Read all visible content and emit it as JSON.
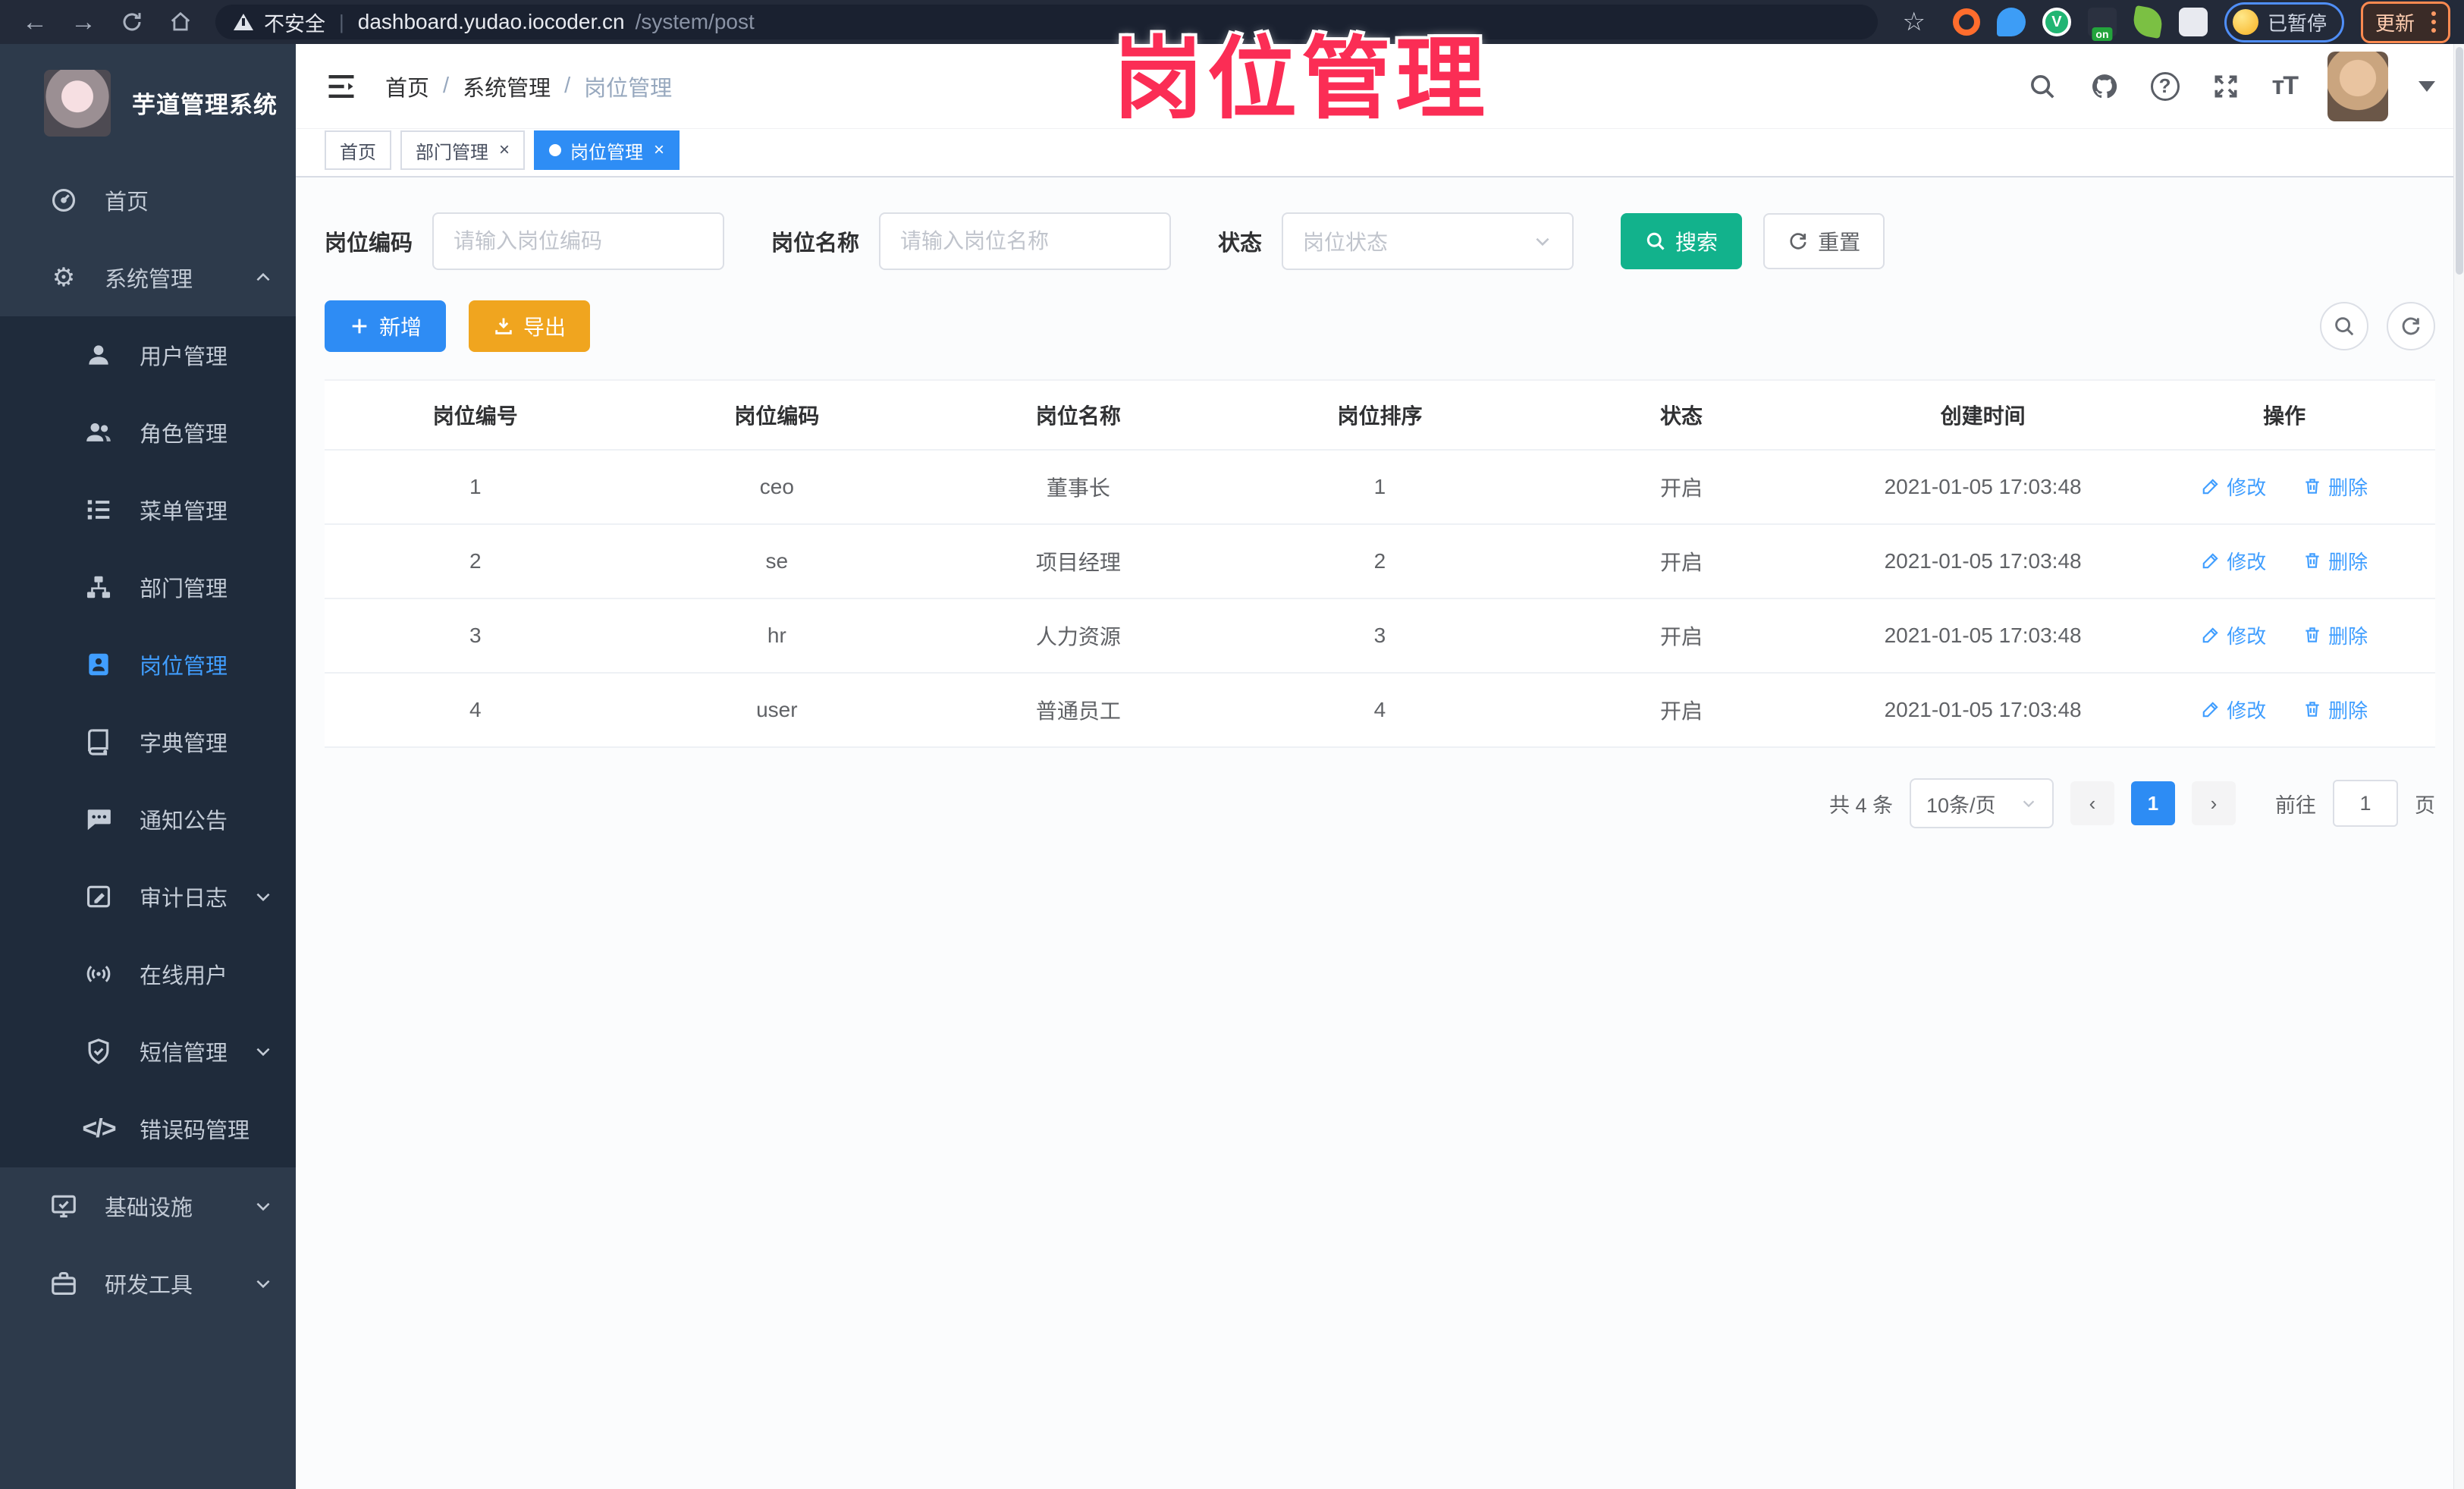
{
  "colors": {
    "primary": "#2e8cf4",
    "success": "#12b28c",
    "warning": "#f0a51f",
    "link": "#409eff",
    "sidebar_bg": "#2d3a4b",
    "submenu_bg": "#1f2b3b",
    "overlay_pink": "#fb2d55"
  },
  "browser": {
    "security_label": "不安全",
    "url_host": "dashboard.yudao.iocoder.cn",
    "url_path": "/system/post",
    "extension_badge": "on",
    "paused_label": "已暂停",
    "update_label": "更新"
  },
  "overlay": {
    "title": "岗位管理"
  },
  "sidebar": {
    "logo_title": "芋道管理系统",
    "items": [
      {
        "label": "首页"
      },
      {
        "label": "系统管理"
      },
      {
        "label": "用户管理"
      },
      {
        "label": "角色管理"
      },
      {
        "label": "菜单管理"
      },
      {
        "label": "部门管理"
      },
      {
        "label": "岗位管理"
      },
      {
        "label": "字典管理"
      },
      {
        "label": "通知公告"
      },
      {
        "label": "审计日志"
      },
      {
        "label": "在线用户"
      },
      {
        "label": "短信管理"
      },
      {
        "label": "错误码管理"
      },
      {
        "label": "基础设施"
      },
      {
        "label": "研发工具"
      }
    ]
  },
  "header": {
    "breadcrumb": [
      "首页",
      "系统管理",
      "岗位管理"
    ]
  },
  "tabs": [
    {
      "label": "首页"
    },
    {
      "label": "部门管理"
    },
    {
      "label": "岗位管理"
    }
  ],
  "filters": {
    "code_label": "岗位编码",
    "code_placeholder": "请输入岗位编码",
    "name_label": "岗位名称",
    "name_placeholder": "请输入岗位名称",
    "status_label": "状态",
    "status_placeholder": "岗位状态",
    "search_label": "搜索",
    "reset_label": "重置"
  },
  "toolbar": {
    "add_label": "新增",
    "export_label": "导出"
  },
  "table": {
    "columns": [
      "岗位编号",
      "岗位编码",
      "岗位名称",
      "岗位排序",
      "状态",
      "创建时间",
      "操作"
    ],
    "edit_label": "修改",
    "delete_label": "删除",
    "rows": [
      {
        "id": "1",
        "code": "ceo",
        "name": "董事长",
        "sort": "1",
        "status": "开启",
        "created": "2021-01-05 17:03:48"
      },
      {
        "id": "2",
        "code": "se",
        "name": "项目经理",
        "sort": "2",
        "status": "开启",
        "created": "2021-01-05 17:03:48"
      },
      {
        "id": "3",
        "code": "hr",
        "name": "人力资源",
        "sort": "3",
        "status": "开启",
        "created": "2021-01-05 17:03:48"
      },
      {
        "id": "4",
        "code": "user",
        "name": "普通员工",
        "sort": "4",
        "status": "开启",
        "created": "2021-01-05 17:03:48"
      }
    ]
  },
  "pagination": {
    "total": "共 4 条",
    "page_size": "10条/页",
    "current_page": "1",
    "goto_label": "前往",
    "goto_value": "1",
    "page_suffix": "页"
  }
}
